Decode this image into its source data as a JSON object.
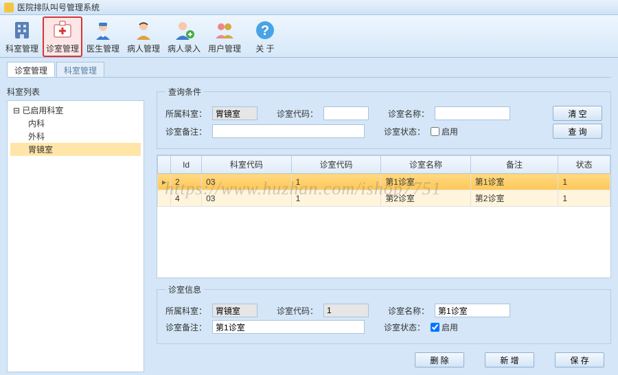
{
  "title": "医院排队叫号管理系统",
  "toolbar": [
    {
      "label": "科室管理",
      "name": "dept-mgmt"
    },
    {
      "label": "诊室管理",
      "name": "room-mgmt"
    },
    {
      "label": "医生管理",
      "name": "doctor-mgmt"
    },
    {
      "label": "病人管理",
      "name": "patient-mgmt"
    },
    {
      "label": "病人录入",
      "name": "patient-entry"
    },
    {
      "label": "用户管理",
      "name": "user-mgmt"
    },
    {
      "label": "关 于",
      "name": "about"
    }
  ],
  "tabs": [
    {
      "label": "诊室管理"
    },
    {
      "label": "科室管理"
    }
  ],
  "tree": {
    "title": "科室列表",
    "root": "已启用科室",
    "children": [
      "内科",
      "外科",
      "胃镜室"
    ]
  },
  "query": {
    "legend": "查询条件",
    "lbl_dept": "所属科室：",
    "val_dept": "胃镜室",
    "lbl_code": "诊室代码：",
    "val_code": "",
    "lbl_name": "诊室名称：",
    "val_name": "",
    "lbl_remark": "诊室备注：",
    "val_remark": "",
    "lbl_state": "诊室状态：",
    "chk_enable": "启用",
    "btn_clear": "清 空",
    "btn_search": "查 询"
  },
  "grid": {
    "cols": [
      "Id",
      "科室代码",
      "诊室代码",
      "诊室名称",
      "备注",
      "状态"
    ],
    "rows": [
      {
        "id": "2",
        "dept": "03",
        "code": "1",
        "name": "第1诊室",
        "remark": "第1诊室",
        "state": "1"
      },
      {
        "id": "4",
        "dept": "03",
        "code": "1",
        "name": "第2诊室",
        "remark": "第2诊室",
        "state": "1"
      }
    ]
  },
  "info": {
    "legend": "诊室信息",
    "lbl_dept": "所属科室：",
    "val_dept": "胃镜室",
    "lbl_code": "诊室代码：",
    "val_code": "1",
    "lbl_name": "诊室名称：",
    "val_name": "第1诊室",
    "lbl_remark": "诊室备注：",
    "val_remark": "第1诊室",
    "lbl_state": "诊室状态：",
    "chk_enable": "启用"
  },
  "actions": {
    "del": "删 除",
    "add": "新 增",
    "save": "保 存"
  },
  "watermark": "https://www.huzhan.com/ishop7751"
}
